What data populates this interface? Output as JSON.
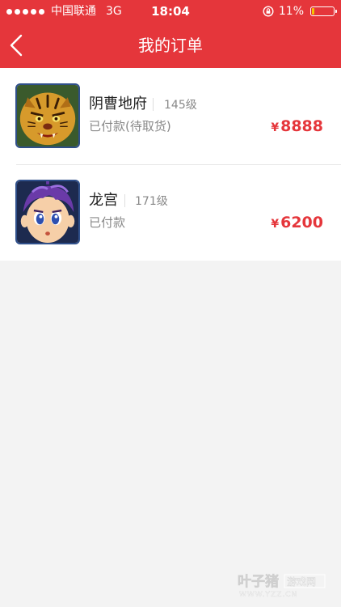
{
  "statusbar": {
    "carrier": "中国联通",
    "network": "3G",
    "time": "18:04",
    "battery_percent": "11%",
    "battery_level": 0.11
  },
  "navbar": {
    "title": "我的订单",
    "back_icon": "chevron-left-icon"
  },
  "orders": [
    {
      "server": "阴曹地府",
      "level": "145级",
      "status": "已付款(待取货)",
      "currency": "¥",
      "price": "8888",
      "avatar_icon": "tiger-demon-avatar"
    },
    {
      "server": "龙宫",
      "level": "171级",
      "status": "已付款",
      "currency": "¥",
      "price": "6200",
      "avatar_icon": "purple-hair-boy-avatar"
    }
  ],
  "watermark": {
    "brand": "叶子猪",
    "sub": "游戏网",
    "url": "WWW.YZZ.CN"
  },
  "colors": {
    "accent": "#e5363b",
    "background": "#f3f3f3",
    "battery": "#f5c400"
  }
}
